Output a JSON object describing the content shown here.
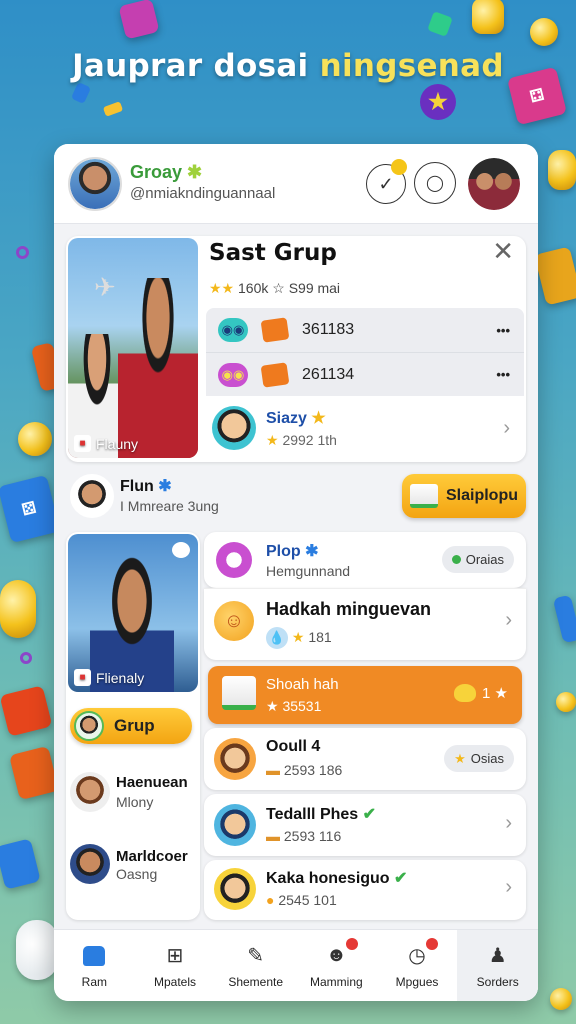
{
  "hero": {
    "title_part1": "Jauprar dosai ",
    "title_part2": "ningsenad"
  },
  "header": {
    "title": "Groay",
    "subtitle": "@nmiakndinguannaal"
  },
  "group_card": {
    "title": "Sast Grup",
    "rating_text": "160k ☆ S99 mai",
    "photo_caption": "Flauny",
    "rows": [
      {
        "value": "361183",
        "menu": "•••"
      },
      {
        "value": "261134",
        "menu": "•••"
      }
    ],
    "member": {
      "name": "Siazy",
      "meta": "2992 1th"
    }
  },
  "profile_row": {
    "name": "Flun",
    "sub": "I Mmreare 3ung",
    "button_label": "Slaiplopu"
  },
  "left_column": {
    "photo_caption": "Flienaly",
    "grup_button": "Grup",
    "contacts": [
      {
        "name": "Haenuean",
        "sub": "Mlony"
      },
      {
        "name": "Marldcoer",
        "sub": "Oasng"
      }
    ]
  },
  "right_column": {
    "top_item": {
      "name": "Plop",
      "sub": "Hemgunnand",
      "pill": "Oraias"
    },
    "feature": {
      "title": "Hadkah minguevan",
      "meta": "181"
    },
    "highlight": {
      "title": "Shoah hah",
      "meta": "35531",
      "badge": "1 ★"
    },
    "items": [
      {
        "name": "Ooull 4",
        "meta": "2593 186",
        "pill": "Osias"
      },
      {
        "name": "Tedalll Phes",
        "meta": "2593 116"
      },
      {
        "name": "Kaka honesiguo",
        "meta": "2545 101"
      }
    ]
  },
  "nav": [
    {
      "label": "Ram",
      "icon": "home-icon"
    },
    {
      "label": "Mpatels",
      "icon": "grid-icon"
    },
    {
      "label": "Shemente",
      "icon": "edit-icon"
    },
    {
      "label": "Mamming",
      "icon": "group-icon"
    },
    {
      "label": "Mpgues",
      "icon": "clock-icon"
    },
    {
      "label": "Sorders",
      "icon": "user-icon"
    }
  ],
  "colors": {
    "accent_orange": "#f08a24",
    "accent_yellow": "#f7c230",
    "header_green": "#3a9b3a"
  }
}
